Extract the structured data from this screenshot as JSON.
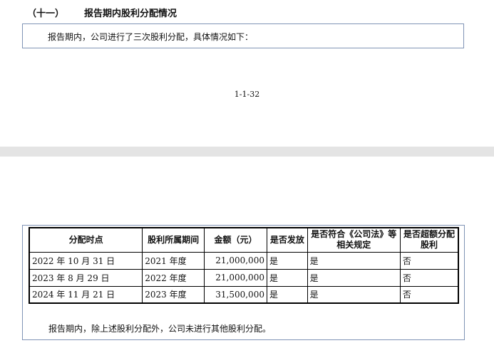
{
  "section": {
    "number": "（十一）",
    "title": "报告期内股利分配情况"
  },
  "intro_text": "报告期内，公司进行了三次股利分配，具体情况如下：",
  "page_number": "1-1-32",
  "table": {
    "headers": [
      "分配时点",
      "股利所属期间",
      "金额（元）",
      "是否发放",
      "是否符合《公司法》等相关规定",
      "是否超额分配股利"
    ],
    "rows": [
      [
        "2022 年 10 月 31 日",
        "2021 年度",
        "21,000,000",
        "是",
        "是",
        "否"
      ],
      [
        "2023 年 8 月 29 日",
        "2022 年度",
        "21,000,000",
        "是",
        "是",
        "否"
      ],
      [
        "2024 年 11 月 21 日",
        "2023 年度",
        "31,500,000",
        "是",
        "是",
        "否"
      ]
    ]
  },
  "footer_text": "报告期内，除上述股利分配外，公司未进行其他股利分配。"
}
